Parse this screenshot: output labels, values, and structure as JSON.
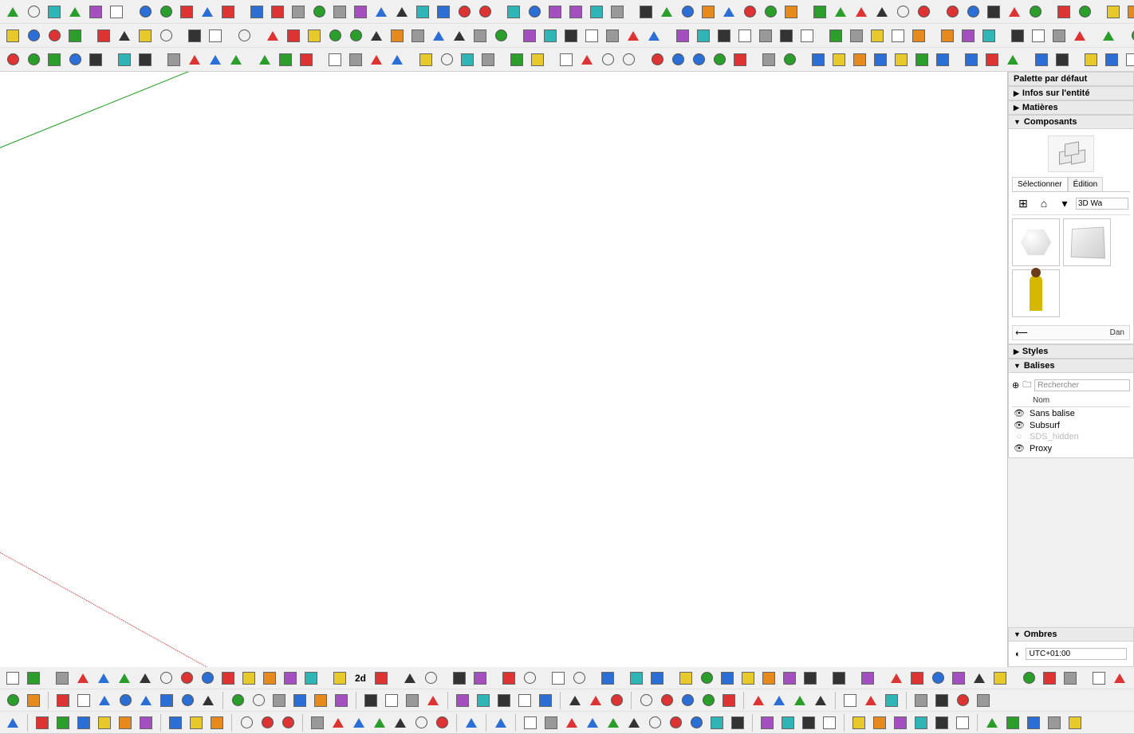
{
  "rpanel": {
    "title": "Palette par défaut",
    "sections": {
      "entity_info": "Infos sur l'entité",
      "materials": "Matières",
      "components": "Composants",
      "styles": "Styles",
      "tags": "Balises",
      "shadows": "Ombres"
    },
    "components": {
      "tabs": {
        "select": "Sélectionner",
        "edit": "Édition"
      },
      "dropdown": "3D Wa",
      "nav_label": "Dan"
    },
    "tags": {
      "search_placeholder": "Rechercher",
      "col_name": "Nom",
      "items": [
        {
          "name": "Sans balise",
          "visible": true
        },
        {
          "name": "Subsurf",
          "visible": true
        },
        {
          "name": "SDS_hidden",
          "visible": false
        },
        {
          "name": "Proxy",
          "visible": true
        }
      ]
    },
    "shadows": {
      "tz": "UTC+01:00"
    }
  },
  "bottom_labels": {
    "mode2d": "2d"
  },
  "toolbar_top": {
    "row1_groups": [
      [
        "eye-blue",
        "drop-blue",
        "page-blue",
        "eye-outline",
        "stack-blue",
        "eye-layers"
      ],
      [
        "flash-black",
        "flash-plus",
        "flash-green",
        "flash-purple",
        "flash-lime"
      ],
      [
        "arc-red",
        "arc2-red",
        "wave-red",
        "bezier",
        "curve-c",
        "rect-orange",
        "rrect-orange",
        "loop-orange",
        "knot",
        "knot2",
        "curve-red",
        "arc-open"
      ],
      [
        "wave-blue",
        "wave2-blue",
        "sine",
        "circle-blue",
        "hoop",
        "hoop-dash"
      ],
      [
        "cube-dk",
        "cubes-dk",
        "layers-dk",
        "cube-out",
        "cubes-out",
        "stack-out",
        "cube-gr",
        "cubes-gr"
      ],
      [
        "layer-a",
        "cube-b",
        "clip",
        "cube-c",
        "cube-d",
        "cube-e"
      ],
      [
        "lay1",
        "lay2",
        "lay-col",
        "lay-red",
        "globe"
      ],
      [
        "chev-gr",
        "fold-up"
      ],
      [
        "graph1",
        "graph2"
      ]
    ],
    "row2_groups": [
      [
        "rarrow-g",
        "rarrow-b",
        "cube-wire",
        "cube-shade"
      ],
      [
        "shirt-y",
        "shirt-b",
        "shirts",
        "warn"
      ],
      [
        "curve-a",
        "curve-b"
      ],
      [
        "fx-icon"
      ],
      [
        "sq-g",
        "sq-o",
        "ang-bl",
        "ang-b2",
        "du-arrow",
        "du-arr2",
        "hdash",
        "rect-bl",
        "sq-dash",
        "arc-r",
        "sel-r",
        "sel-bl"
      ],
      [
        "cube-r1",
        "cube-r2",
        "cube-r3",
        "cube-r4",
        "cube-r5",
        "cube-r6",
        "cube-r7"
      ],
      [
        "box-br1",
        "box-br2",
        "box-br3",
        "box-br4",
        "box-br5",
        "box-rA",
        "box-rB"
      ],
      [
        "globe2",
        "pin",
        "user-o",
        "tag-g",
        "dl"
      ],
      [
        "sheet1",
        "sheet2",
        "sheet3"
      ],
      [
        "plane1",
        "plane2",
        "plane3",
        "plane4"
      ],
      [
        "line-bw"
      ],
      [
        "shape-a",
        "shape-b"
      ]
    ],
    "row3_groups": [
      [
        "person-y",
        "person-y2",
        "person-k",
        "pic",
        "gear"
      ],
      [
        "ruler-a",
        "ruler-b"
      ],
      [
        "rot-a",
        "rot-b",
        "rot-c",
        "rot-d"
      ],
      [
        "undo",
        "cube-rot",
        "redo"
      ],
      [
        "win-a",
        "win-b",
        "win-c",
        "win-d"
      ],
      [
        "sel-cur",
        "sel-box",
        "sel-add",
        "sel-sub"
      ],
      [
        "flag-rb",
        "flag-kw"
      ],
      [
        "sq-w",
        "sq-gr",
        "sq-k",
        "sq-o2"
      ],
      [
        "mv-a",
        "mv-b",
        "sk-a",
        "sk-b",
        "sk-c"
      ],
      [
        "ptr-r",
        "ptr-bl"
      ],
      [
        "ln",
        "sq3",
        "sq4",
        "poly",
        "circ",
        "arc3",
        "arc4"
      ],
      [
        "box3",
        "paint",
        "ptr"
      ],
      [
        "sel-in",
        "selall"
      ],
      [
        "sq-r",
        "dup-r",
        "rot-r"
      ]
    ]
  },
  "toolbar_bottom": {
    "row1_groups": [
      [
        "ptr2",
        "frame"
      ],
      [
        "grid1",
        "grid2",
        "grid3",
        "grid4",
        "grid5",
        "grid6",
        "grid7",
        "grid8",
        "check",
        "persp1",
        "persp2",
        "persp3",
        "persp4"
      ],
      [
        "bar-o",
        "txt-2d",
        "monitor"
      ],
      [
        "chip1",
        "chip2"
      ],
      [
        "flask",
        "drop"
      ],
      [
        "mirror-h",
        "mirror-v"
      ],
      [
        "undo2",
        "redo2"
      ],
      [
        "sweep"
      ],
      [
        "ring",
        "ring2"
      ],
      [
        "diag",
        "rect-d",
        "pts1",
        "pts2",
        "pts3",
        "pts4",
        "kcut"
      ],
      [
        "fold"
      ],
      [
        "page-o"
      ],
      [
        "flag2",
        "play",
        "stop",
        "end",
        "loopctl",
        "slow"
      ],
      [
        "tie1",
        "tie2",
        "ptr3"
      ],
      [
        "cross",
        "grab",
        "scale",
        "rot3",
        "wrap"
      ],
      [
        "help"
      ],
      [
        "net1",
        "net2",
        "net3",
        "net4",
        "net5",
        "net6"
      ]
    ],
    "row2_groups": [
      [
        "pencil",
        "helix"
      ],
      [
        "plus-g",
        "plus-o",
        "x-b",
        "tri-b",
        "hex-g",
        "hex-p",
        "cyl",
        "cone"
      ],
      [
        "cut-r",
        "cut-o",
        "undo3",
        "arc-g",
        "arc-g2",
        "arc-g3"
      ],
      [
        "cubelet1",
        "cubelet2",
        "cubelet3",
        "cubelet4"
      ],
      [
        "g3a",
        "g3b",
        "g3c",
        "g3d",
        "burst"
      ],
      [
        "ln-b",
        "flag-it",
        "chip3"
      ],
      [
        "h0",
        "h1",
        "h2",
        "h3",
        "h4"
      ],
      [
        "sh1",
        "sh2",
        "sh3",
        "sh4"
      ],
      [
        "swatch",
        "ptr4",
        "lay-a"
      ],
      [
        "glb",
        "jewel",
        "jewel2",
        "cube-q"
      ]
    ],
    "row3_groups": [
      [
        "ptr5"
      ],
      [
        "g4a",
        "g4b",
        "g4c",
        "g4d",
        "g4e",
        "g4f"
      ],
      [
        "cA",
        "cB",
        "cC"
      ],
      [
        "bw1",
        "bw2",
        "bwtool"
      ],
      [
        "winA",
        "winB",
        "winC",
        "winD",
        "winE",
        "winF",
        "winG"
      ],
      [
        "pen"
      ],
      [
        "xbox"
      ],
      [
        "iso1",
        "iso2",
        "iso3",
        "iso4",
        "iso5",
        "iso6",
        "iso7",
        "iso8",
        "iso9",
        "isoA",
        "isoB"
      ],
      [
        "cubeL",
        "cubeM",
        "cubeN",
        "cubeO"
      ],
      [
        "dia1",
        "dia2",
        "dia3",
        "dia4",
        "dia5",
        "dia6"
      ],
      [
        "ptr6",
        "zoom-a",
        "zoom-b",
        "move2",
        "rot4"
      ]
    ]
  }
}
